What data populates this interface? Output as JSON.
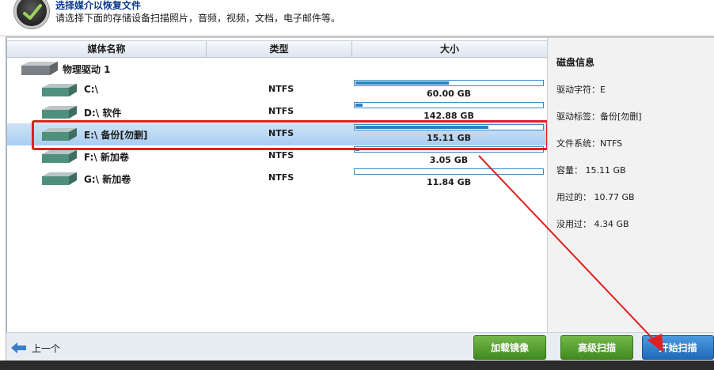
{
  "header": {
    "title": "选择媒介以恢复文件",
    "subtitle": "请选择下面的存储设备扫描照片，音频，视频，文档，电子邮件等。",
    "logo_icon": "app-logo-icon"
  },
  "table": {
    "columns": [
      "媒体名称",
      "类型",
      "大小"
    ],
    "root_label": "物理驱动 1",
    "rows": [
      {
        "name": "C:\\",
        "type": "NTFS",
        "size": "60.00 GB",
        "used_fraction": 0.5,
        "selected": false
      },
      {
        "name": "D:\\ 软件",
        "type": "NTFS",
        "size": "142.88 GB",
        "used_fraction": 0.04,
        "selected": false
      },
      {
        "name": "E:\\ 备份[勿删]",
        "type": "NTFS",
        "size": "15.11 GB",
        "used_fraction": 0.71,
        "selected": true
      },
      {
        "name": "F:\\ 新加卷",
        "type": "NTFS",
        "size": "3.05 GB",
        "used_fraction": 0.02,
        "selected": false
      },
      {
        "name": "G:\\ 新加卷",
        "type": "NTFS",
        "size": "11.84 GB",
        "used_fraction": 0.0,
        "selected": false
      }
    ]
  },
  "disk_info": {
    "title": "磁盘信息",
    "drive_letter": "驱动字符：E",
    "drive_label": "驱动标签：备份[勿删]",
    "file_system": "文件系统：NTFS",
    "capacity": "容量： 15.11 GB",
    "used": "用过的： 10.77 GB",
    "unused": "没用过： 4.34 GB"
  },
  "footer": {
    "back_label": "上一个",
    "load_image_label": "加载镜像",
    "advanced_scan_label": "高级扫描",
    "start_scan_label": "开始扫描"
  },
  "colors": {
    "accent_blue": "#2f7fbf",
    "selection": "#a9cdf2",
    "green_button": "#4f9a2a",
    "blue_button": "#2a78c4",
    "annotation_red": "#e02020"
  }
}
